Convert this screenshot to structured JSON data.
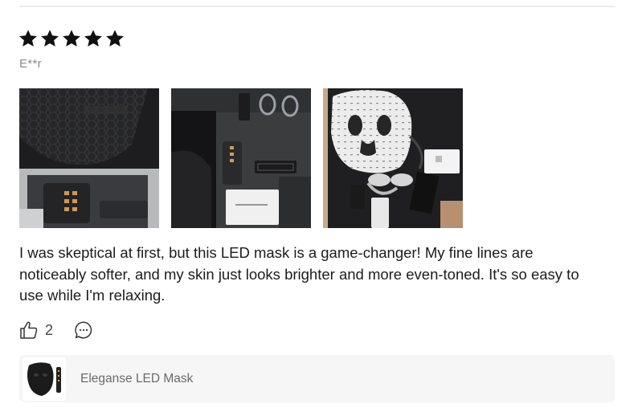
{
  "review": {
    "rating": 5,
    "rating_max": 5,
    "reviewer": "E**r",
    "text": "I was skeptical at first, but this LED mask is a game-changer! My fine lines are noticeably softer, and my skin just looks brighter and more even-toned. It's so easy to use while I'm relaxing.",
    "likes": "2"
  },
  "photos": [
    {
      "name": "review-photo-1"
    },
    {
      "name": "review-photo-2"
    },
    {
      "name": "review-photo-3"
    }
  ],
  "product": {
    "name": "Eleganse LED Mask"
  },
  "icons": {
    "star": "star-icon",
    "like": "thumbs-up-icon",
    "comment": "comment-bubble-icon"
  },
  "colors": {
    "star": "#111111",
    "text": "#1c1c1c",
    "muted": "#8a8a8a",
    "card_bg": "#f6f6f6",
    "divider": "#ececec"
  }
}
